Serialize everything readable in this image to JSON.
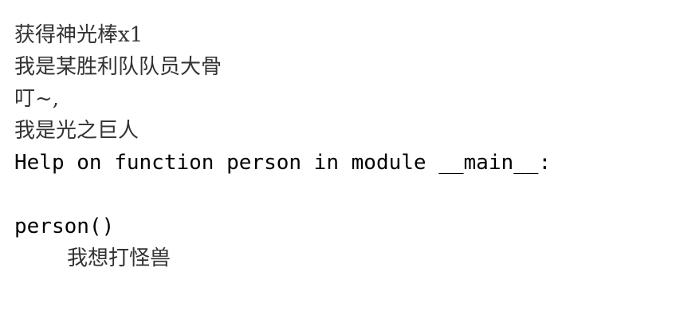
{
  "console": {
    "lines": [
      "获得神光棒x1",
      "我是某胜利队队员大骨",
      "叮~,",
      "我是光之巨人",
      "Help on function person in module __main__:",
      "",
      "person()",
      "我想打怪兽"
    ]
  }
}
